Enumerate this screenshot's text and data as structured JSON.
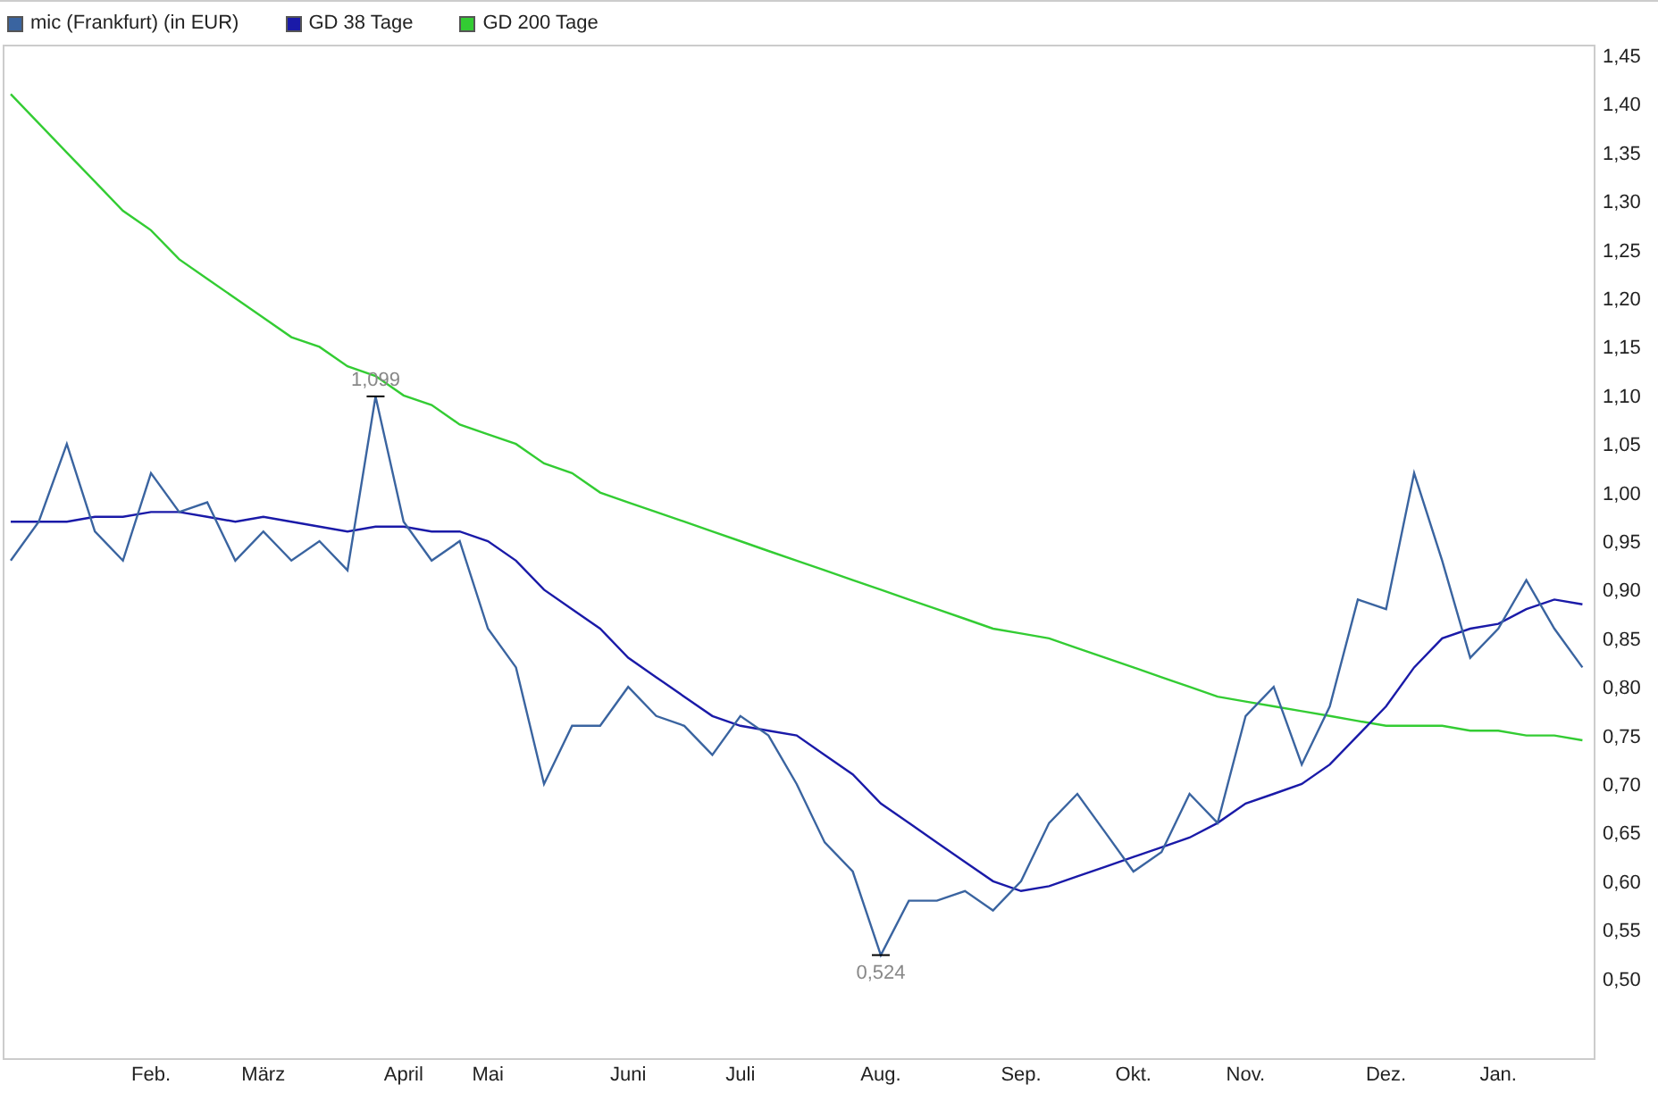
{
  "chart_data": {
    "type": "line",
    "ylim": [
      0.417,
      1.461
    ],
    "categories": [
      null,
      null,
      null,
      null,
      null,
      "Feb.",
      null,
      null,
      null,
      "März",
      null,
      null,
      null,
      null,
      "April",
      null,
      null,
      "Mai",
      null,
      null,
      null,
      null,
      "Juni",
      null,
      null,
      null,
      "Juli",
      null,
      null,
      null,
      null,
      "Aug.",
      null,
      null,
      null,
      null,
      "Sep.",
      null,
      null,
      null,
      "Okt.",
      null,
      null,
      null,
      "Nov.",
      null,
      null,
      null,
      null,
      "Dez.",
      null,
      null,
      null,
      "Jan.",
      null,
      null,
      null
    ],
    "yticks": [
      {
        "value": 0.5,
        "label": "0,50"
      },
      {
        "value": 0.55,
        "label": "0,55"
      },
      {
        "value": 0.6,
        "label": "0,60"
      },
      {
        "value": 0.65,
        "label": "0,65"
      },
      {
        "value": 0.7,
        "label": "0,70"
      },
      {
        "value": 0.75,
        "label": "0,75"
      },
      {
        "value": 0.8,
        "label": "0,80"
      },
      {
        "value": 0.85,
        "label": "0,85"
      },
      {
        "value": 0.9,
        "label": "0,90"
      },
      {
        "value": 0.95,
        "label": "0,95"
      },
      {
        "value": 1.0,
        "label": "1,00"
      },
      {
        "value": 1.05,
        "label": "1,05"
      },
      {
        "value": 1.1,
        "label": "1,10"
      },
      {
        "value": 1.15,
        "label": "1,15"
      },
      {
        "value": 1.2,
        "label": "1,20"
      },
      {
        "value": 1.25,
        "label": "1,25"
      },
      {
        "value": 1.3,
        "label": "1,30"
      },
      {
        "value": 1.35,
        "label": "1,35"
      },
      {
        "value": 1.4,
        "label": "1,40"
      },
      {
        "value": 1.45,
        "label": "1,45"
      }
    ],
    "series": [
      {
        "name": "mic (Frankfurt) (in EUR)",
        "color": "#3a64a0",
        "values": [
          0.93,
          0.97,
          1.05,
          0.96,
          0.93,
          1.02,
          0.98,
          0.99,
          0.93,
          0.96,
          0.93,
          0.95,
          0.92,
          1.099,
          0.97,
          0.93,
          0.95,
          0.86,
          0.82,
          0.7,
          0.76,
          0.76,
          0.8,
          0.77,
          0.76,
          0.73,
          0.77,
          0.75,
          0.7,
          0.64,
          0.61,
          0.524,
          0.58,
          0.58,
          0.59,
          0.57,
          0.6,
          0.66,
          0.69,
          0.65,
          0.61,
          0.63,
          0.69,
          0.66,
          0.77,
          0.8,
          0.72,
          0.78,
          0.89,
          0.88,
          1.02,
          0.93,
          0.83,
          0.86,
          0.91,
          0.86,
          0.82
        ]
      },
      {
        "name": "GD 38 Tage",
        "color": "#1a1aa8",
        "values": [
          0.97,
          0.97,
          0.97,
          0.975,
          0.975,
          0.98,
          0.98,
          0.975,
          0.97,
          0.975,
          0.97,
          0.965,
          0.96,
          0.965,
          0.965,
          0.96,
          0.96,
          0.95,
          0.93,
          0.9,
          0.88,
          0.86,
          0.83,
          0.81,
          0.79,
          0.77,
          0.76,
          0.755,
          0.75,
          0.73,
          0.71,
          0.68,
          0.66,
          0.64,
          0.62,
          0.6,
          0.59,
          0.595,
          0.605,
          0.615,
          0.625,
          0.635,
          0.645,
          0.66,
          0.68,
          0.69,
          0.7,
          0.72,
          0.75,
          0.78,
          0.82,
          0.85,
          0.86,
          0.865,
          0.88,
          0.89,
          0.885
        ]
      },
      {
        "name": "GD 200 Tage",
        "color": "#33cc33",
        "values": [
          1.41,
          1.38,
          1.35,
          1.32,
          1.29,
          1.27,
          1.24,
          1.22,
          1.2,
          1.18,
          1.16,
          1.15,
          1.13,
          1.12,
          1.1,
          1.09,
          1.07,
          1.06,
          1.05,
          1.03,
          1.02,
          1.0,
          0.99,
          0.98,
          0.97,
          0.96,
          0.95,
          0.94,
          0.93,
          0.92,
          0.91,
          0.9,
          0.89,
          0.88,
          0.87,
          0.86,
          0.855,
          0.85,
          0.84,
          0.83,
          0.82,
          0.81,
          0.8,
          0.79,
          0.785,
          0.78,
          0.775,
          0.77,
          0.765,
          0.76,
          0.76,
          0.76,
          0.755,
          0.755,
          0.75,
          0.75,
          0.745
        ]
      }
    ],
    "annotations": [
      {
        "y": 1.099,
        "text": "1,099"
      },
      {
        "y": 0.524,
        "text": "0,524"
      }
    ]
  }
}
